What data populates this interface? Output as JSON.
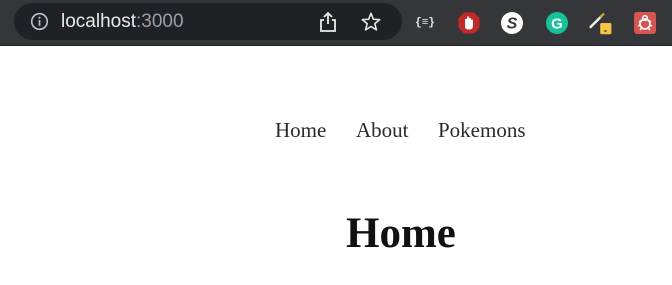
{
  "browser": {
    "url_host": "localhost",
    "url_port": ":3000",
    "extensions": [
      {
        "name": "json-viewer",
        "label": "{≡}"
      },
      {
        "name": "ublock"
      },
      {
        "name": "s-extension",
        "label": "S"
      },
      {
        "name": "grammarly",
        "label": "G"
      },
      {
        "name": "pen-tool"
      },
      {
        "name": "bug-extension"
      }
    ]
  },
  "nav": {
    "links": [
      {
        "label": "Home"
      },
      {
        "label": "About"
      },
      {
        "label": "Pokemons"
      }
    ]
  },
  "main": {
    "heading": "Home"
  },
  "colors": {
    "toolbar_bg": "#35363a",
    "omnibox_bg": "#202124",
    "ublock_red": "#c62828",
    "grammarly_green": "#15c39a",
    "bug_bg": "#d9534f",
    "badge_yellow": "#f4c542"
  }
}
